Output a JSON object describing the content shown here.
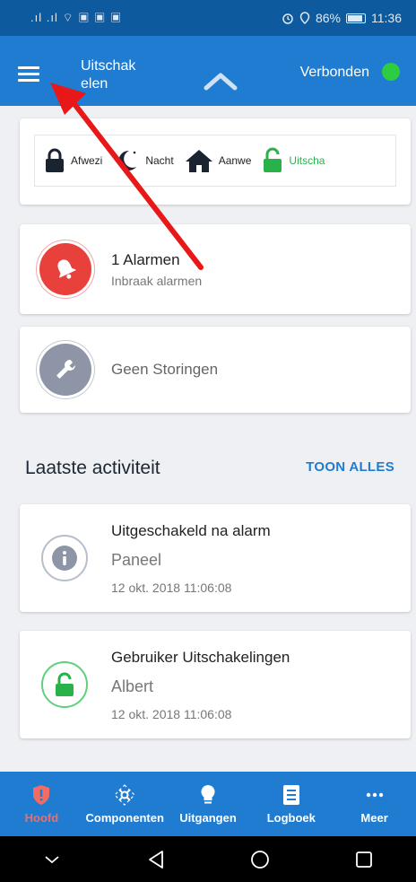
{
  "status_bar": {
    "left_indicators": ".ıl .ıl ⌔ ▣ ▣ ▣",
    "battery": "86%",
    "time": "11:36"
  },
  "app_bar": {
    "title": "Uitschakelen",
    "connection_status": "Verbonden",
    "connection_color": "#2ecc40"
  },
  "modes": [
    {
      "label": "Afwezi",
      "icon": "lock-closed-icon"
    },
    {
      "label": "Nacht",
      "icon": "moon-star-icon"
    },
    {
      "label": "Aanwe",
      "icon": "home-icon"
    },
    {
      "label": "Uitscha",
      "icon": "lock-open-icon",
      "active": true
    }
  ],
  "alarm_card": {
    "title": "1 Alarmen",
    "subtitle": "Inbraak alarmen"
  },
  "storing_card": {
    "title": "Geen Storingen"
  },
  "activity": {
    "section_title": "Laatste activiteit",
    "show_all": "TOON ALLES",
    "items": [
      {
        "title": "Uitgeschakeld na alarm",
        "who": "Paneel",
        "time": "12 okt. 2018 11:06:08",
        "icon": "info-icon"
      },
      {
        "title": "Gebruiker Uitschakelingen",
        "who": "Albert",
        "time": "12 okt. 2018 11:06:08",
        "icon": "lock-open-icon"
      }
    ]
  },
  "bottom_nav": [
    {
      "label": "Hoofd",
      "icon": "shield-icon",
      "active": true
    },
    {
      "label": "Componenten",
      "icon": "components-icon"
    },
    {
      "label": "Uitgangen",
      "icon": "bulb-icon"
    },
    {
      "label": "Logboek",
      "icon": "logbook-icon"
    },
    {
      "label": "Meer",
      "icon": "more-icon"
    }
  ],
  "colors": {
    "primary": "#1f7cd0",
    "status_bar": "#0e5a9e",
    "alarm_red": "#e8403a",
    "active_green": "#2ab24a",
    "annotation_arrow": "#e81818"
  }
}
